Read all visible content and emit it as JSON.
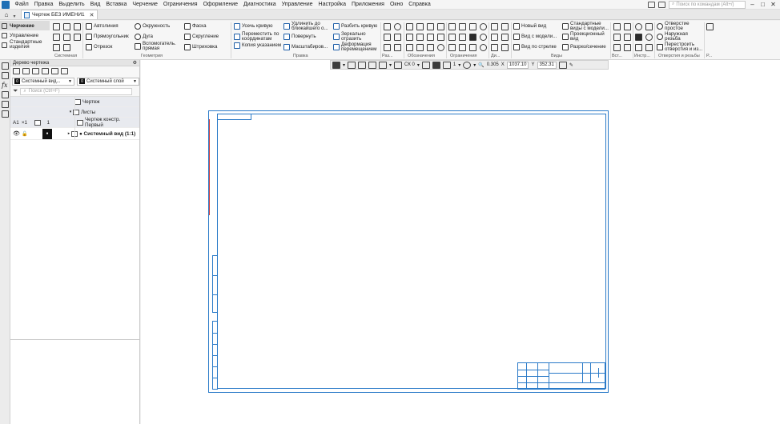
{
  "menu": {
    "items": [
      "Файл",
      "Правка",
      "Выделить",
      "Вид",
      "Вставка",
      "Черчение",
      "Ограничения",
      "Оформление",
      "Диагностика",
      "Управление",
      "Настройка",
      "Приложения",
      "Окно",
      "Справка"
    ],
    "search_placeholder": "Поиск по командам (Alt+/)"
  },
  "tabs": {
    "document_tab": "Чертеж БЕЗ ИМЕНИ1"
  },
  "ribbon": {
    "modes": [
      "Черчение",
      "Управление",
      "Стандартные изделия"
    ],
    "system": {
      "label": "Системная"
    },
    "geometry": {
      "items": [
        "Автолиния",
        "Прямоугольник",
        "Отрезок",
        "Окружность",
        "Дуга",
        "Вспомогатель. прямая",
        "Фаска",
        "Скругление",
        "Штриховка"
      ],
      "label": "Геометрия"
    },
    "edit": {
      "items": [
        "Усечь кривую",
        "Переместить по координатам",
        "Копия указанием",
        "Удлинить до ближайшего о...",
        "Повернуть",
        "Масштабиров...",
        "Разбить кривую",
        "Зеркально отразить",
        "Деформация перемещением"
      ],
      "label": "Правка"
    },
    "groups_short": [
      "Раз...",
      "Обозначения",
      "Ограничения",
      "Ди...",
      "Виды",
      "Вст...",
      "Инстр...",
      "Отверстия и резьбы",
      "Р..."
    ],
    "views": {
      "items": [
        "Новый вид",
        "Вид с модели...",
        "Вид по стрелке",
        "Стандартные виды с модели...",
        "Проекционный вид",
        "Разрез/сечение"
      ]
    },
    "holes": {
      "items": [
        "Отверстие простое",
        "Наружная резьба",
        "Перестроить отверстия и из..."
      ]
    }
  },
  "tree_panel": {
    "title": "Дерево чертежа",
    "view_select": "Системный вид...",
    "view_select_num": "0",
    "layer_select": "Системный слой",
    "layer_select_num": "0",
    "search_placeholder": "Поиск (Ctrl+F)",
    "rows": {
      "drawing": "Чертеж",
      "sheets": "Листы",
      "sheet_format": "A1",
      "sheet_scale": "×1",
      "sheet_number": "1",
      "sheet_name": "Чертеж констр. Первый",
      "system_view": "● Системный вид (1:1)"
    }
  },
  "canvas_toolbar": {
    "cs": "СК 0",
    "step": "1",
    "zoom": "0.305",
    "x_label": "X",
    "x_value": "1037.10",
    "y_label": "Y",
    "y_value": "352.31"
  },
  "colors": {
    "sheet_border": "#2a7ac8",
    "accent_red": "#d04040"
  }
}
